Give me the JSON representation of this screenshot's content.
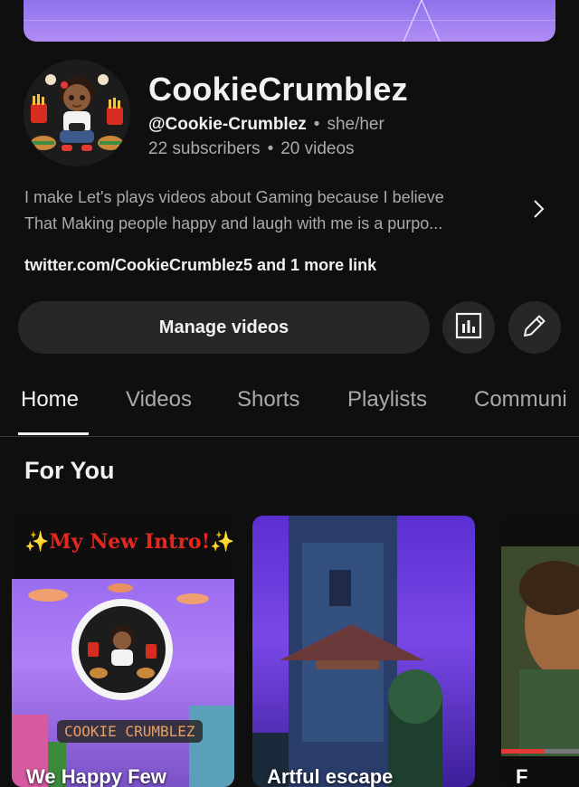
{
  "channel": {
    "name": "CookieCrumblez",
    "handle": "@Cookie-Crumblez",
    "pronouns": "she/her",
    "subscribers": "22 subscribers",
    "videos": "20 videos",
    "description_line1": "I make Let's plays videos about Gaming because I believe",
    "description_line2": "That Making people happy and laugh with me is a purpo...",
    "links": "twitter.com/CookieCrumblez5 and 1 more link"
  },
  "actions": {
    "manage_label": "Manage videos",
    "analytics_icon": "analytics-icon",
    "edit_icon": "pencil-icon"
  },
  "tabs": [
    "Home",
    "Videos",
    "Shorts",
    "Playlists",
    "Communi"
  ],
  "section": {
    "title": "For You"
  },
  "cards": [
    {
      "title": "We Happy Few",
      "overlay_top": "✨My New Intro!✨",
      "overlay_badge": "COOKIE CRUMBLEZ"
    },
    {
      "title": "Artful escape"
    },
    {
      "title": "F"
    }
  ],
  "colors": {
    "background": "#0f0f0f",
    "button_bg": "#272727",
    "secondary_text": "#aaaaaa",
    "intro_red": "#e5281f",
    "banner_purple": "#9b7cf0"
  }
}
